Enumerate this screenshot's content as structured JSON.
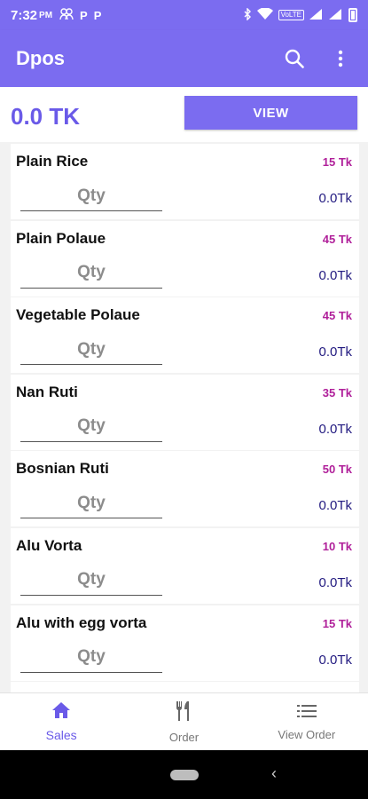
{
  "status_bar": {
    "time": "7:32",
    "time_suffix": "PM",
    "app_icon_1": "P",
    "app_icon_2": "P",
    "network_badge": "VoLTE"
  },
  "app_bar": {
    "title": "Dpos"
  },
  "summary": {
    "total": "0.0 TK",
    "view_label": "VIEW"
  },
  "items": [
    {
      "name": "Plain Rice",
      "price": "15 Tk",
      "qty_placeholder": "Qty",
      "subtotal": "0.0Tk"
    },
    {
      "name": "Plain Polaue",
      "price": "45 Tk",
      "qty_placeholder": "Qty",
      "subtotal": "0.0Tk"
    },
    {
      "name": "Vegetable Polaue",
      "price": "45 Tk",
      "qty_placeholder": "Qty",
      "subtotal": "0.0Tk"
    },
    {
      "name": "Nan Ruti",
      "price": "35 Tk",
      "qty_placeholder": "Qty",
      "subtotal": "0.0Tk"
    },
    {
      "name": "Bosnian Ruti",
      "price": "50 Tk",
      "qty_placeholder": "Qty",
      "subtotal": "0.0Tk"
    },
    {
      "name": "Alu Vorta",
      "price": "10 Tk",
      "qty_placeholder": "Qty",
      "subtotal": "0.0Tk"
    },
    {
      "name": "Alu with egg vorta",
      "price": "15 Tk",
      "qty_placeholder": "Qty",
      "subtotal": "0.0Tk"
    }
  ],
  "bottom_nav": {
    "sales": "Sales",
    "order": "Order",
    "view_order": "View Order"
  },
  "colors": {
    "primary": "#7b6cf0",
    "accent_text": "#6a5ae8",
    "price": "#b0209a",
    "subtotal": "#221a80"
  },
  "icons": {
    "search": "search-icon",
    "menu": "more-vert-icon",
    "sales": "home-icon",
    "order": "fork-knife-icon",
    "view_order": "list-icon"
  }
}
